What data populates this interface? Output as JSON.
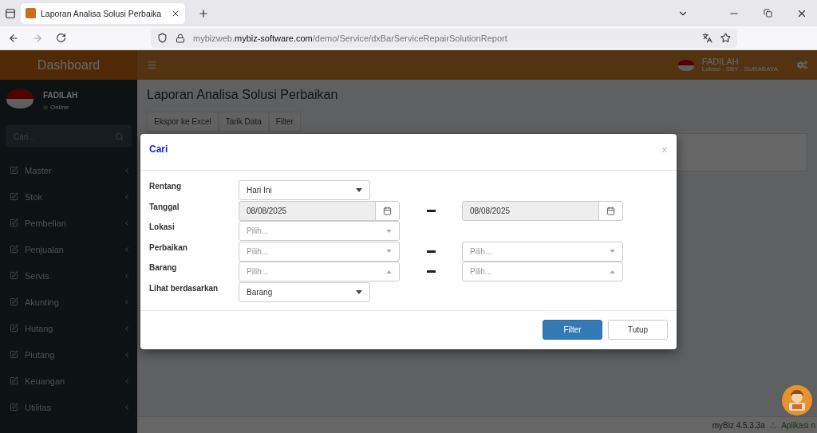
{
  "browser": {
    "tab_title": "Laporan Analisa Solusi Perbaika",
    "url": "mybizweb.**mybiz-software.com**/demo/Service/dxBarServiceRepairSolutionReport"
  },
  "header": {
    "brand": "Dashboard",
    "user_name": "FADILAH",
    "location": "Lokasi : SBY - SURABAYA"
  },
  "sidebar": {
    "user_name": "FADILAH",
    "status": "Online",
    "search_placeholder": "Cari...",
    "items": [
      {
        "label": "Master"
      },
      {
        "label": "Stok"
      },
      {
        "label": "Pembelian"
      },
      {
        "label": "Penjualan"
      },
      {
        "label": "Servis"
      },
      {
        "label": "Akunting"
      },
      {
        "label": "Hutang"
      },
      {
        "label": "Piutang"
      },
      {
        "label": "Keuangan"
      },
      {
        "label": "Utilitas"
      }
    ]
  },
  "page": {
    "title": "Laporan Analisa Solusi Perbaikan",
    "toolbar": [
      "Ekspor ke Excel",
      "Tarik Data",
      "Filter"
    ]
  },
  "modal": {
    "title": "Cari",
    "close": "×",
    "rows": [
      {
        "label": "Rentang",
        "fields": [
          {
            "kind": "select",
            "value": "Hari Ini"
          }
        ]
      },
      {
        "label": "Tanggal",
        "fields": [
          {
            "kind": "date",
            "value": "08/08/2025"
          },
          {
            "kind": "date",
            "value": "08/08/2025"
          }
        ]
      },
      {
        "label": "Lokasi",
        "fields": [
          {
            "kind": "combo",
            "placeholder": "Pilih...",
            "expanded": false
          }
        ]
      },
      {
        "label": "Perbaikan",
        "fields": [
          {
            "kind": "combo",
            "placeholder": "Pilih...",
            "expanded": false
          },
          {
            "kind": "combo",
            "placeholder": "Pilih...",
            "expanded": false
          }
        ]
      },
      {
        "label": "Barang",
        "fields": [
          {
            "kind": "combo",
            "placeholder": "Pilih...",
            "expanded": true
          },
          {
            "kind": "combo",
            "placeholder": "Pilih...",
            "expanded": true
          }
        ]
      },
      {
        "label": "Lihat berdasarkan",
        "fields": [
          {
            "kind": "select",
            "value": "Barang"
          }
        ]
      }
    ],
    "buttons": [
      {
        "label": "Filter",
        "kind": "primary"
      },
      {
        "label": "Tutup",
        "kind": "default"
      }
    ]
  },
  "footer": {
    "version": "myBiz 4.5.3.3a",
    "separator": ".:.",
    "note": "Aplikasi n"
  }
}
